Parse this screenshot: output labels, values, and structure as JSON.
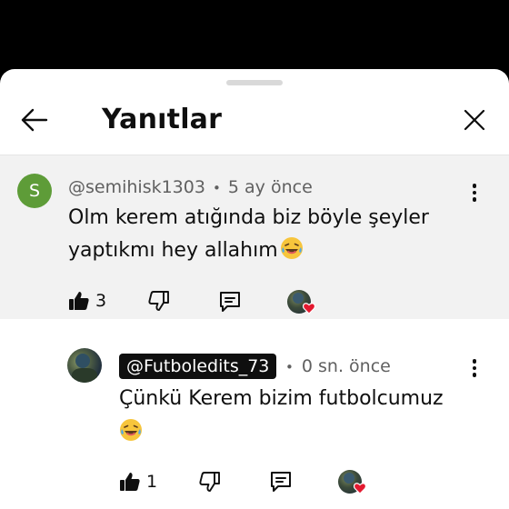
{
  "header": {
    "title": "Yanıtlar"
  },
  "parent_comment": {
    "avatar_letter": "S",
    "author": "@semihisk1303",
    "separator": "•",
    "time": "5 ay önce",
    "text_line1": "Olm kerem atığında biz böyle şeyler",
    "text_line2": "yaptıkmı hey allahım",
    "likes": "3"
  },
  "reply": {
    "author": "@Futboledits_73",
    "separator": "•",
    "time": "0 sn. önce",
    "text_line1": "Çünkü Kerem bizim futbolcumuz",
    "likes": "1"
  },
  "colors": {
    "avatar_s_bg": "#5e9c38",
    "parent_bg": "#f2f2f2",
    "heart": "#e3192f",
    "chip_bg": "#0f0f0f"
  },
  "icons": [
    "back-arrow-icon",
    "close-icon",
    "more-vert-icon",
    "thumbs-up-filled-icon",
    "thumbs-down-icon",
    "reply-icon",
    "creator-heart-icon",
    "laughing-emoji-icon"
  ]
}
